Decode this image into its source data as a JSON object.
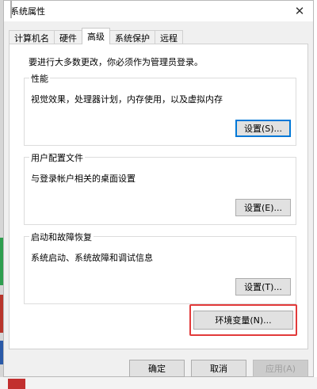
{
  "window": {
    "title": "系统属性"
  },
  "tabs": [
    {
      "label": "计算机名"
    },
    {
      "label": "硬件"
    },
    {
      "label": "高级"
    },
    {
      "label": "系统保护"
    },
    {
      "label": "远程"
    }
  ],
  "active_tab": "高级",
  "intro": "要进行大多数更改，你必须作为管理员登录。",
  "performance": {
    "title": "性能",
    "description": "视觉效果，处理器计划，内存使用，以及虚拟内存",
    "button": "设置(S)..."
  },
  "user_profiles": {
    "title": "用户配置文件",
    "description": "与登录帐户相关的桌面设置",
    "button": "设置(E)..."
  },
  "startup": {
    "title": "启动和故障恢复",
    "description": "系统启动、系统故障和调试信息",
    "button": "设置(T)..."
  },
  "env_button": "环境变量(N)...",
  "footer": {
    "ok": "确定",
    "cancel": "取消",
    "apply": "应用(A)"
  },
  "colors": {
    "highlight": "#e23a3a",
    "accent": "#0078d7"
  }
}
